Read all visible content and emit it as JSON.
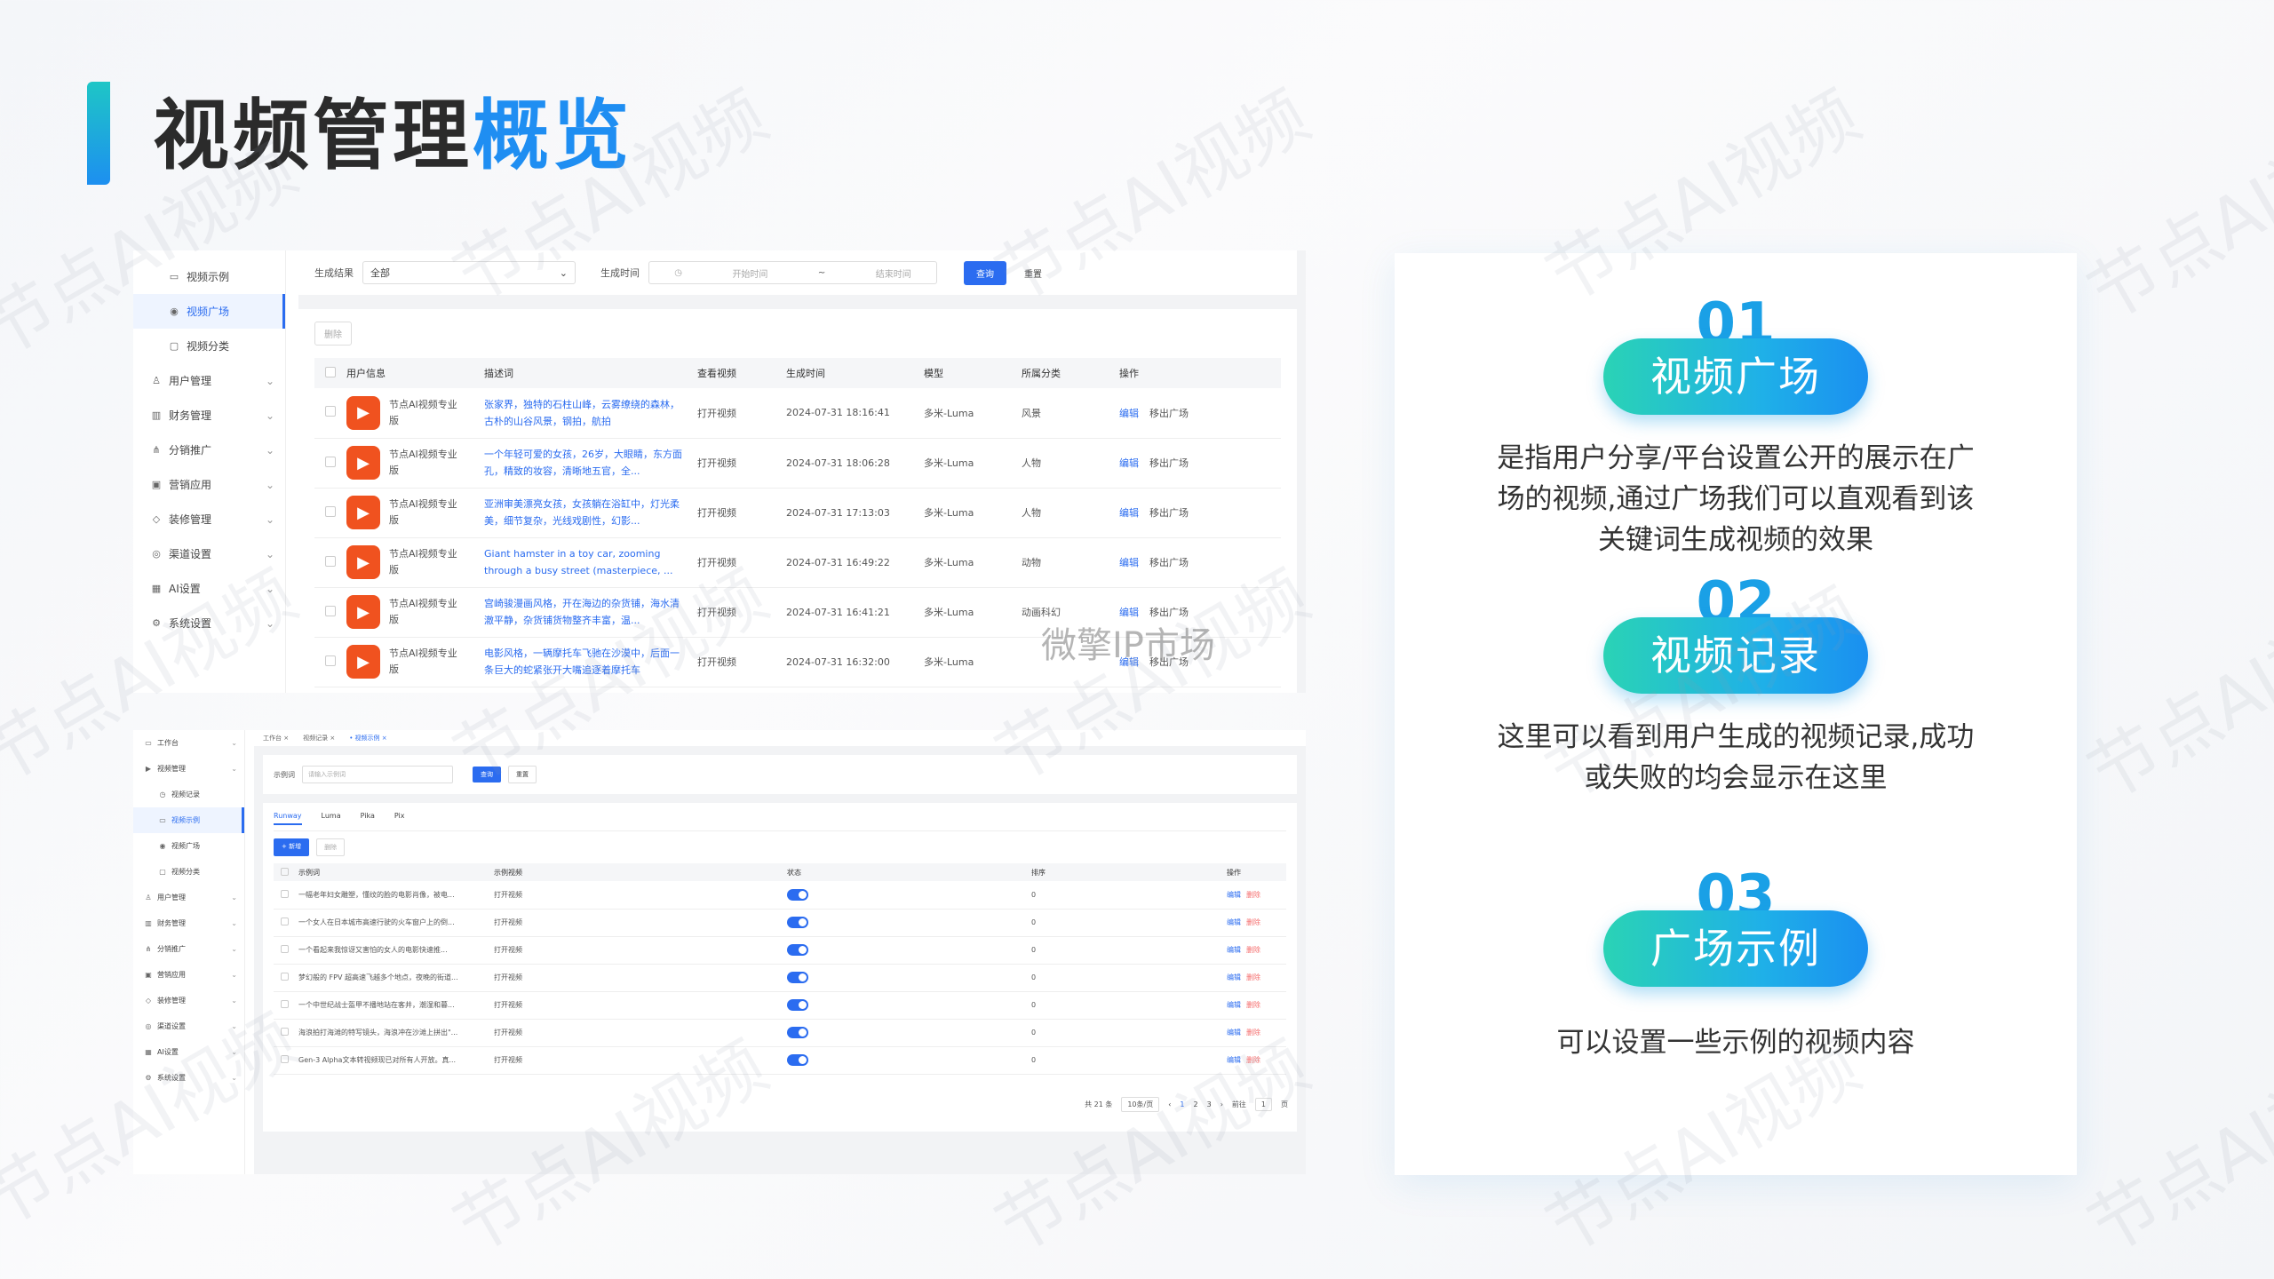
{
  "page": {
    "title_main": "视频管理",
    "title_accent": "概览",
    "watermark": "节点AI视频",
    "ip_watermark": "微擎IP市场"
  },
  "shot1": {
    "sidebar": [
      {
        "label": "视频示例",
        "icon": "monitor-icon",
        "sub": true,
        "active": false
      },
      {
        "label": "视频广场",
        "icon": "eye-icon",
        "sub": true,
        "active": true
      },
      {
        "label": "视频分类",
        "icon": "folder-icon",
        "sub": true,
        "active": false
      },
      {
        "label": "用户管理",
        "icon": "user-icon",
        "sub": false,
        "active": false
      },
      {
        "label": "财务管理",
        "icon": "chart-icon",
        "sub": false,
        "active": false
      },
      {
        "label": "分销推广",
        "icon": "share-icon",
        "sub": false,
        "active": false
      },
      {
        "label": "营销应用",
        "icon": "gift-icon",
        "sub": false,
        "active": false
      },
      {
        "label": "装修管理",
        "icon": "brush-icon",
        "sub": false,
        "active": false
      },
      {
        "label": "渠道设置",
        "icon": "channel-icon",
        "sub": false,
        "active": false
      },
      {
        "label": "AI设置",
        "icon": "ai-icon",
        "sub": false,
        "active": false
      },
      {
        "label": "系统设置",
        "icon": "gear-icon",
        "sub": false,
        "active": false
      }
    ],
    "filter": {
      "result_label": "生成结果",
      "result_value": "全部",
      "time_label": "生成时间",
      "start_placeholder": "开始时间",
      "sep": "~",
      "end_placeholder": "结束时间",
      "search": "查询",
      "reset": "重置"
    },
    "delete": "删除",
    "columns": [
      "用户信息",
      "描述词",
      "查看视频",
      "生成时间",
      "模型",
      "所属分类",
      "操作"
    ],
    "rows": [
      {
        "user": "节点AI视频专业版",
        "desc": "张家界，独特的石柱山峰，云雾缭绕的森林，古朴的山谷风景，钢拍，航拍",
        "view": "打开视频",
        "time": "2024-07-31 18:16:41",
        "model": "多米-Luma",
        "cat": "风景",
        "edit": "编辑",
        "move": "移出广场"
      },
      {
        "user": "节点AI视频专业版",
        "desc": "一个年轻可爱的女孩，26岁，大眼睛，东方面孔，精致的妆容，清晰地五官，全...",
        "view": "打开视频",
        "time": "2024-07-31 18:06:28",
        "model": "多米-Luma",
        "cat": "人物",
        "edit": "编辑",
        "move": "移出广场"
      },
      {
        "user": "节点AI视频专业版",
        "desc": "亚洲审美漂亮女孩，女孩躺在浴缸中，灯光柔美，细节复杂，光线戏剧性，幻影...",
        "view": "打开视频",
        "time": "2024-07-31 17:13:03",
        "model": "多米-Luma",
        "cat": "人物",
        "edit": "编辑",
        "move": "移出广场"
      },
      {
        "user": "节点AI视频专业版",
        "desc": "Giant hamster in a toy car, zooming through a busy street (masterpiece, ...",
        "view": "打开视频",
        "time": "2024-07-31 16:49:22",
        "model": "多米-Luma",
        "cat": "动物",
        "edit": "编辑",
        "move": "移出广场"
      },
      {
        "user": "节点AI视频专业版",
        "desc": "宫崎骏漫画风格，开在海边的杂货铺，海水清澈平静，杂货铺货物整齐丰富，温...",
        "view": "打开视频",
        "time": "2024-07-31 16:41:21",
        "model": "多米-Luma",
        "cat": "动画科幻",
        "edit": "编辑",
        "move": "移出广场"
      },
      {
        "user": "节点AI视频专业版",
        "desc": "电影风格，一辆摩托车飞驰在沙漠中，后面一条巨大的蛇紧张开大嘴追逐着摩托车",
        "view": "打开视频",
        "time": "2024-07-31 16:32:00",
        "model": "多米-Luma",
        "cat": "",
        "edit": "编辑",
        "move": "移出广场"
      }
    ]
  },
  "shot2": {
    "sidebar": [
      {
        "label": "工作台",
        "icon": "desk-icon",
        "sub": false,
        "active": false
      },
      {
        "label": "视频管理",
        "icon": "video-icon",
        "sub": false,
        "active": false
      },
      {
        "label": "视频记录",
        "icon": "record-icon",
        "sub": true,
        "active": false
      },
      {
        "label": "视频示例",
        "icon": "monitor-icon",
        "sub": true,
        "active": true
      },
      {
        "label": "视频广场",
        "icon": "eye-icon",
        "sub": true,
        "active": false
      },
      {
        "label": "视频分类",
        "icon": "folder-icon",
        "sub": true,
        "active": false
      },
      {
        "label": "用户管理",
        "icon": "user-icon",
        "sub": false,
        "active": false
      },
      {
        "label": "财务管理",
        "icon": "chart-icon",
        "sub": false,
        "active": false
      },
      {
        "label": "分销推广",
        "icon": "share-icon",
        "sub": false,
        "active": false
      },
      {
        "label": "营销应用",
        "icon": "gift-icon",
        "sub": false,
        "active": false
      },
      {
        "label": "装修管理",
        "icon": "brush-icon",
        "sub": false,
        "active": false
      },
      {
        "label": "渠道设置",
        "icon": "channel-icon",
        "sub": false,
        "active": false
      },
      {
        "label": "AI设置",
        "icon": "ai-icon",
        "sub": false,
        "active": false
      },
      {
        "label": "系统设置",
        "icon": "gear-icon",
        "sub": false,
        "active": false
      }
    ],
    "tabs": [
      "工作台 ×",
      "视频记录 ×",
      "• 视频示例 ×"
    ],
    "filter": {
      "label": "示例词",
      "placeholder": "请输入示例词",
      "search": "查询",
      "reset": "重置"
    },
    "panel_tabs": [
      "Runway",
      "Luma",
      "Pika",
      "Pix"
    ],
    "add": "+ 新增",
    "delete": "删除",
    "columns": [
      "示例词",
      "示例视频",
      "状态",
      "排序",
      "操作"
    ],
    "rows": [
      {
        "word": "一幅老年妇女雕塑，懂纹的脸的电影肖像，被电...",
        "video": "打开视频",
        "sort": "0",
        "edit": "编辑",
        "del": "删除"
      },
      {
        "word": "一个女人在日本城市高速行驶的火车窗户上的倒...",
        "video": "打开视频",
        "sort": "0",
        "edit": "编辑",
        "del": "删除"
      },
      {
        "word": "一个看起来我惊讶又害怕的女人的电影快速推...",
        "video": "打开视频",
        "sort": "0",
        "edit": "编辑",
        "del": "删除"
      },
      {
        "word": "梦幻般的 FPV 超高速飞越多个地点，夜晚的街道...",
        "video": "打开视频",
        "sort": "0",
        "edit": "编辑",
        "del": "删除"
      },
      {
        "word": "一个中世纪战士盔甲不播地站在客井，潮湿和暮...",
        "video": "打开视频",
        "sort": "0",
        "edit": "编辑",
        "del": "删除"
      },
      {
        "word": "海浪拍打海滩的特写镜头，海浪冲在沙滩上拼出\"...",
        "video": "打开视频",
        "sort": "0",
        "edit": "编辑",
        "del": "删除"
      },
      {
        "word": "Gen-3 Alpha文本转视频现已对所有人开放。真...",
        "video": "打开视频",
        "sort": "0",
        "edit": "编辑",
        "del": "删除"
      }
    ],
    "pager": {
      "total": "共 21 条",
      "size": "10条/页",
      "prev": "‹",
      "pages": [
        "1",
        "2",
        "3"
      ],
      "next": "›",
      "goto": "前往",
      "page_input": "1",
      "page_unit": "页"
    }
  },
  "features": [
    {
      "num": "01",
      "title": "视频广场",
      "desc": "是指用户分享/平台设置公开的展示在广场的视频,通过广场我们可以直观看到该关键词生成视频的效果"
    },
    {
      "num": "02",
      "title": "视频记录",
      "desc": "这里可以看到用户生成的视频记录,成功或失败的均会显示在这里"
    },
    {
      "num": "03",
      "title": "广场示例",
      "desc": "可以设置一些示例的视频内容"
    }
  ],
  "colors": {
    "accent": "#1f8ef2",
    "primary": "#2b6cf0",
    "avatar": "#f0521f",
    "pill_start": "#2ad3b5",
    "pill_end": "#1a8ff0"
  }
}
